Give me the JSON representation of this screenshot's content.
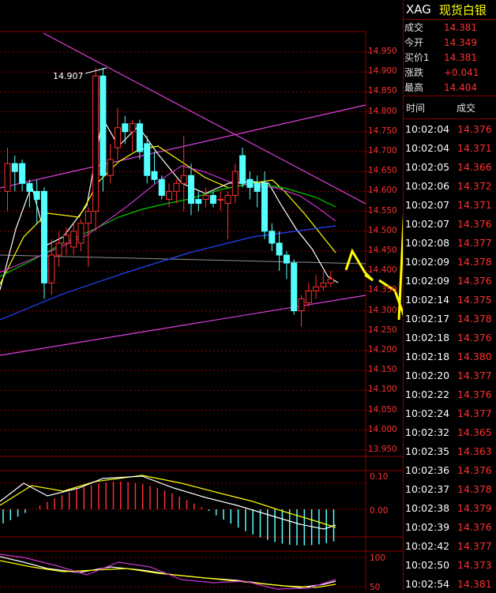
{
  "symbol": {
    "code": "XAG",
    "name": "现货白银"
  },
  "stats": [
    {
      "label": "成交",
      "value": "14.381"
    },
    {
      "label": "今开",
      "value": "14.349"
    },
    {
      "label": "买价1",
      "value": "14.381"
    },
    {
      "label": "涨跌",
      "value": "+0.041"
    },
    {
      "label": "最高",
      "value": "14.404"
    }
  ],
  "trades_header": {
    "time": "时间",
    "price": "成交"
  },
  "trades": [
    {
      "time": "10:02:04",
      "price": "14.376"
    },
    {
      "time": "10:02:04",
      "price": "14.371"
    },
    {
      "time": "10:02:05",
      "price": "14.366"
    },
    {
      "time": "10:02:06",
      "price": "14.372"
    },
    {
      "time": "10:02:07",
      "price": "14.371"
    },
    {
      "time": "10:02:07",
      "price": "14.376"
    },
    {
      "time": "10:02:08",
      "price": "14.377"
    },
    {
      "time": "10:02:09",
      "price": "14.378"
    },
    {
      "time": "10:02:09",
      "price": "14.376"
    },
    {
      "time": "10:02:14",
      "price": "14.375"
    },
    {
      "time": "10:02:17",
      "price": "14.378"
    },
    {
      "time": "10:02:18",
      "price": "14.376"
    },
    {
      "time": "10:02:18",
      "price": "14.380"
    },
    {
      "time": "10:02:20",
      "price": "14.377"
    },
    {
      "time": "10:02:22",
      "price": "14.376"
    },
    {
      "time": "10:02:24",
      "price": "14.377"
    },
    {
      "time": "10:02:32",
      "price": "14.365"
    },
    {
      "time": "10:02:35",
      "price": "14.363"
    },
    {
      "time": "10:02:36",
      "price": "14.376"
    },
    {
      "time": "10:02:37",
      "price": "14.378"
    },
    {
      "time": "10:02:38",
      "price": "14.379"
    },
    {
      "time": "10:02:39",
      "price": "14.376"
    },
    {
      "time": "10:02:42",
      "price": "14.377"
    },
    {
      "time": "10:02:50",
      "price": "14.373"
    },
    {
      "time": "10:02:54",
      "price": "14.381"
    }
  ],
  "price_axis": [
    "14.950",
    "14.900",
    "14.850",
    "14.800",
    "14.750",
    "14.700",
    "14.650",
    "14.600",
    "14.550",
    "14.500",
    "14.450",
    "14.400",
    "14.350",
    "14.300",
    "14.250",
    "14.200",
    "14.150",
    "14.100",
    "14.050",
    "14.000",
    "13.950"
  ],
  "high_annotation": "14.907",
  "macd_axis": [
    "0.10",
    "0.00"
  ],
  "kdj_axis": [
    "100",
    "50"
  ],
  "colors": {
    "up": "#ff3030",
    "down": "#54ffff",
    "grid": "#8b0000",
    "arrow": "#ffff00"
  },
  "chart_data": {
    "type": "candlestick",
    "ylim": [
      13.95,
      14.95
    ],
    "candles": [
      {
        "o": 14.6,
        "h": 14.71,
        "l": 14.55,
        "c": 14.67
      },
      {
        "o": 14.67,
        "h": 14.69,
        "l": 14.6,
        "c": 14.65
      },
      {
        "o": 14.67,
        "h": 14.68,
        "l": 14.6,
        "c": 14.62
      },
      {
        "o": 14.62,
        "h": 14.63,
        "l": 14.56,
        "c": 14.6
      },
      {
        "o": 14.6,
        "h": 14.63,
        "l": 14.52,
        "c": 14.58
      },
      {
        "o": 14.6,
        "h": 14.61,
        "l": 14.33,
        "c": 14.37
      },
      {
        "o": 14.37,
        "h": 14.48,
        "l": 14.34,
        "c": 14.44
      },
      {
        "o": 14.44,
        "h": 14.5,
        "l": 14.41,
        "c": 14.47
      },
      {
        "o": 14.47,
        "h": 14.51,
        "l": 14.44,
        "c": 14.49
      },
      {
        "o": 14.46,
        "h": 14.52,
        "l": 14.44,
        "c": 14.5
      },
      {
        "o": 14.47,
        "h": 14.53,
        "l": 14.45,
        "c": 14.52
      },
      {
        "o": 14.52,
        "h": 14.56,
        "l": 14.41,
        "c": 14.55
      },
      {
        "o": 14.55,
        "h": 14.91,
        "l": 14.5,
        "c": 14.89
      },
      {
        "o": 14.89,
        "h": 14.91,
        "l": 14.6,
        "c": 14.64
      },
      {
        "o": 14.64,
        "h": 14.72,
        "l": 14.62,
        "c": 14.68
      },
      {
        "o": 14.71,
        "h": 14.81,
        "l": 14.68,
        "c": 14.76
      },
      {
        "o": 14.77,
        "h": 14.79,
        "l": 14.72,
        "c": 14.75
      },
      {
        "o": 14.75,
        "h": 14.78,
        "l": 14.7,
        "c": 14.77
      },
      {
        "o": 14.77,
        "h": 14.78,
        "l": 14.68,
        "c": 14.7
      },
      {
        "o": 14.72,
        "h": 14.74,
        "l": 14.62,
        "c": 14.64
      },
      {
        "o": 14.65,
        "h": 14.7,
        "l": 14.62,
        "c": 14.63
      },
      {
        "o": 14.63,
        "h": 14.64,
        "l": 14.58,
        "c": 14.59
      },
      {
        "o": 14.58,
        "h": 14.62,
        "l": 14.56,
        "c": 14.6
      },
      {
        "o": 14.6,
        "h": 14.63,
        "l": 14.57,
        "c": 14.62
      },
      {
        "o": 14.62,
        "h": 14.74,
        "l": 14.55,
        "c": 14.64
      },
      {
        "o": 14.64,
        "h": 14.67,
        "l": 14.54,
        "c": 14.57
      },
      {
        "o": 14.58,
        "h": 14.6,
        "l": 14.55,
        "c": 14.57
      },
      {
        "o": 14.58,
        "h": 14.61,
        "l": 14.56,
        "c": 14.59
      },
      {
        "o": 14.59,
        "h": 14.6,
        "l": 14.56,
        "c": 14.57
      },
      {
        "o": 14.58,
        "h": 14.6,
        "l": 14.55,
        "c": 14.58
      },
      {
        "o": 14.57,
        "h": 14.6,
        "l": 14.48,
        "c": 14.59
      },
      {
        "o": 14.59,
        "h": 14.67,
        "l": 14.57,
        "c": 14.65
      },
      {
        "o": 14.69,
        "h": 14.71,
        "l": 14.61,
        "c": 14.62
      },
      {
        "o": 14.63,
        "h": 14.65,
        "l": 14.58,
        "c": 14.61
      },
      {
        "o": 14.62,
        "h": 14.64,
        "l": 14.56,
        "c": 14.6
      },
      {
        "o": 14.62,
        "h": 14.65,
        "l": 14.48,
        "c": 14.5
      },
      {
        "o": 14.5,
        "h": 14.52,
        "l": 14.45,
        "c": 14.47
      },
      {
        "o": 14.47,
        "h": 14.5,
        "l": 14.4,
        "c": 14.44
      },
      {
        "o": 14.44,
        "h": 14.45,
        "l": 14.38,
        "c": 14.42
      },
      {
        "o": 14.42,
        "h": 14.43,
        "l": 14.29,
        "c": 14.3
      },
      {
        "o": 14.3,
        "h": 14.34,
        "l": 14.26,
        "c": 14.33
      },
      {
        "o": 14.32,
        "h": 14.37,
        "l": 14.31,
        "c": 14.35
      },
      {
        "o": 14.35,
        "h": 14.39,
        "l": 14.33,
        "c": 14.36
      },
      {
        "o": 14.36,
        "h": 14.4,
        "l": 14.35,
        "c": 14.37
      },
      {
        "o": 14.37,
        "h": 14.4,
        "l": 14.36,
        "c": 14.38
      }
    ]
  }
}
